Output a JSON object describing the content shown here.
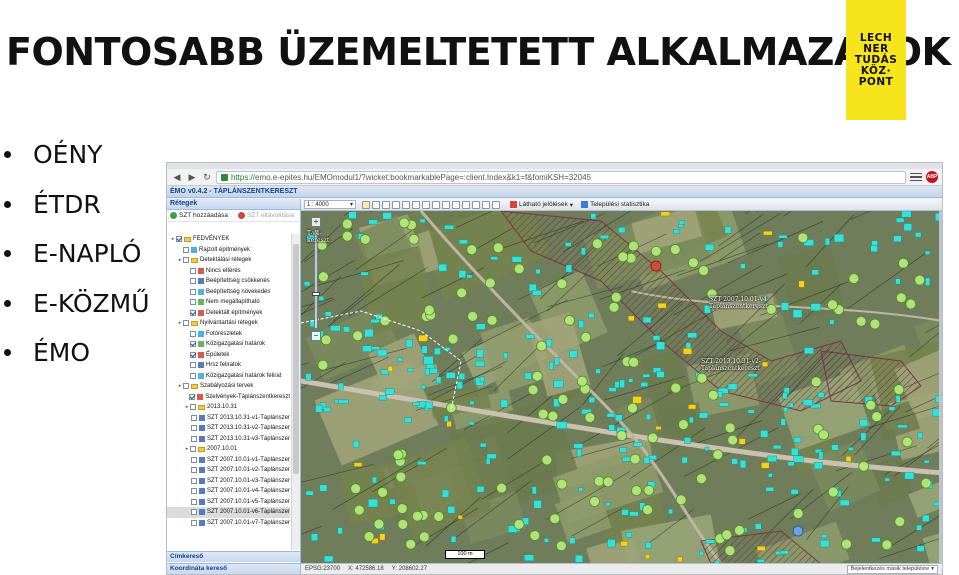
{
  "slide": {
    "title": "FONTOSABB ÜZEMELTETETT ALKALMAZÁSOK",
    "logo_lines": [
      "LECH",
      "NER",
      "TUDÁS",
      "KÖZ·",
      "PONT"
    ],
    "bullets": [
      "OÉNY",
      "ÉTDR",
      "E-NAPLÓ",
      "E-KÖZMŰ",
      "ÉMO"
    ]
  },
  "browser": {
    "url_secure": "https://",
    "url_rest": "emo.e-epites.hu/EMOmodul1/?wicket:bookmarkablePage=:client.Index&k1=f&fomiKSH=32045",
    "badge": "ABP"
  },
  "app": {
    "header_title": "ÉMO v0.4.2 - TÁPLÁNSZENTKERESZT",
    "layers_panel_title": "Rétegek",
    "add_szt_label": "SZT hozzáadása",
    "remove_szt_label": "SZT eltávolítása",
    "tree": [
      {
        "label": "FEDVÉNYEK",
        "depth": 0,
        "type": "folder",
        "checked": true
      },
      {
        "label": "Rajzolt építmények",
        "depth": 1,
        "type": "layer",
        "checked": false
      },
      {
        "label": "Detektálási rétegek",
        "depth": 1,
        "type": "folder",
        "checked": false
      },
      {
        "label": "Nincs eltérés",
        "depth": 2,
        "type": "layer",
        "checked": false
      },
      {
        "label": "Beépítettség csökkenés",
        "depth": 2,
        "type": "layer",
        "checked": false
      },
      {
        "label": "Beépítettség növekedés",
        "depth": 2,
        "type": "layer",
        "checked": false
      },
      {
        "label": "Nem megállapítható",
        "depth": 2,
        "type": "layer",
        "checked": false
      },
      {
        "label": "Detektált építmények",
        "depth": 2,
        "type": "layer",
        "checked": true
      },
      {
        "label": "Nyilvántartási rétegek",
        "depth": 1,
        "type": "folder",
        "checked": false
      },
      {
        "label": "Fotórészletek",
        "depth": 2,
        "type": "layer",
        "checked": false
      },
      {
        "label": "Közigazgatási határok",
        "depth": 2,
        "type": "layer",
        "checked": true
      },
      {
        "label": "Épületek",
        "depth": 2,
        "type": "layer",
        "checked": true
      },
      {
        "label": "Hrsz feliratok",
        "depth": 2,
        "type": "layer",
        "checked": false
      },
      {
        "label": "Közigazgatási határok felirat",
        "depth": 2,
        "type": "layer",
        "checked": false
      },
      {
        "label": "Szabályozási tervek",
        "depth": 1,
        "type": "folder",
        "checked": false
      },
      {
        "label": "Szelvények-Táplánszentkereszt",
        "depth": 2,
        "type": "layer",
        "checked": true
      },
      {
        "label": "2013.10.31",
        "depth": 2,
        "type": "folder",
        "checked": false
      },
      {
        "label": "SZT 2013.10.31-v1-Táplánszen",
        "depth": 3,
        "type": "layer",
        "checked": false
      },
      {
        "label": "SZT 2013.10.31-v2-Táplánszen",
        "depth": 3,
        "type": "layer",
        "checked": false
      },
      {
        "label": "SZT 2013.10.31-v3-Táplánszen",
        "depth": 3,
        "type": "layer",
        "checked": false
      },
      {
        "label": "2007.10.01",
        "depth": 2,
        "type": "folder",
        "checked": false
      },
      {
        "label": "SZT 2007.10.01-v1-Táplánszen",
        "depth": 3,
        "type": "layer",
        "checked": false
      },
      {
        "label": "SZT 2007.10.01-v2-Táplánszen",
        "depth": 3,
        "type": "layer",
        "checked": false
      },
      {
        "label": "SZT 2007.10.01-v3-Táplánszen",
        "depth": 3,
        "type": "layer",
        "checked": false
      },
      {
        "label": "SZT 2007.10.01-v4-Táplánszen",
        "depth": 3,
        "type": "layer",
        "checked": false
      },
      {
        "label": "SZT 2007.10.01-v5-Táplánszen",
        "depth": 3,
        "type": "layer",
        "checked": false
      },
      {
        "label": "SZT 2007.10.01-v6-Táplánszen",
        "depth": 3,
        "type": "layer",
        "checked": false
      },
      {
        "label": "SZT 2007.10.01-v7-Táplánszen",
        "depth": 3,
        "type": "layer",
        "checked": false
      }
    ],
    "bottom_panels": [
      "Címkereső",
      "Koordináta kereső"
    ],
    "toolbar": {
      "scale_value": "1 : 4000",
      "visible_label": "Látható jelölések",
      "stats_label": "Települési statisztika"
    },
    "map": {
      "annotation_1": "SZT 2007.10.01-v4-\nTáplánszentkereszt",
      "annotation_2": "SZT 2013.10.31-v2-\nTáplánszentkereszt",
      "annotation_left": "T-v4-\nkereszt",
      "scalebar_label": "100 m"
    },
    "status": {
      "epsg": "EPSG:23700",
      "x": "X: 472586.18",
      "y": "Y: 208602.27",
      "other_settlement": "Bejelentkezés másik településre"
    }
  }
}
